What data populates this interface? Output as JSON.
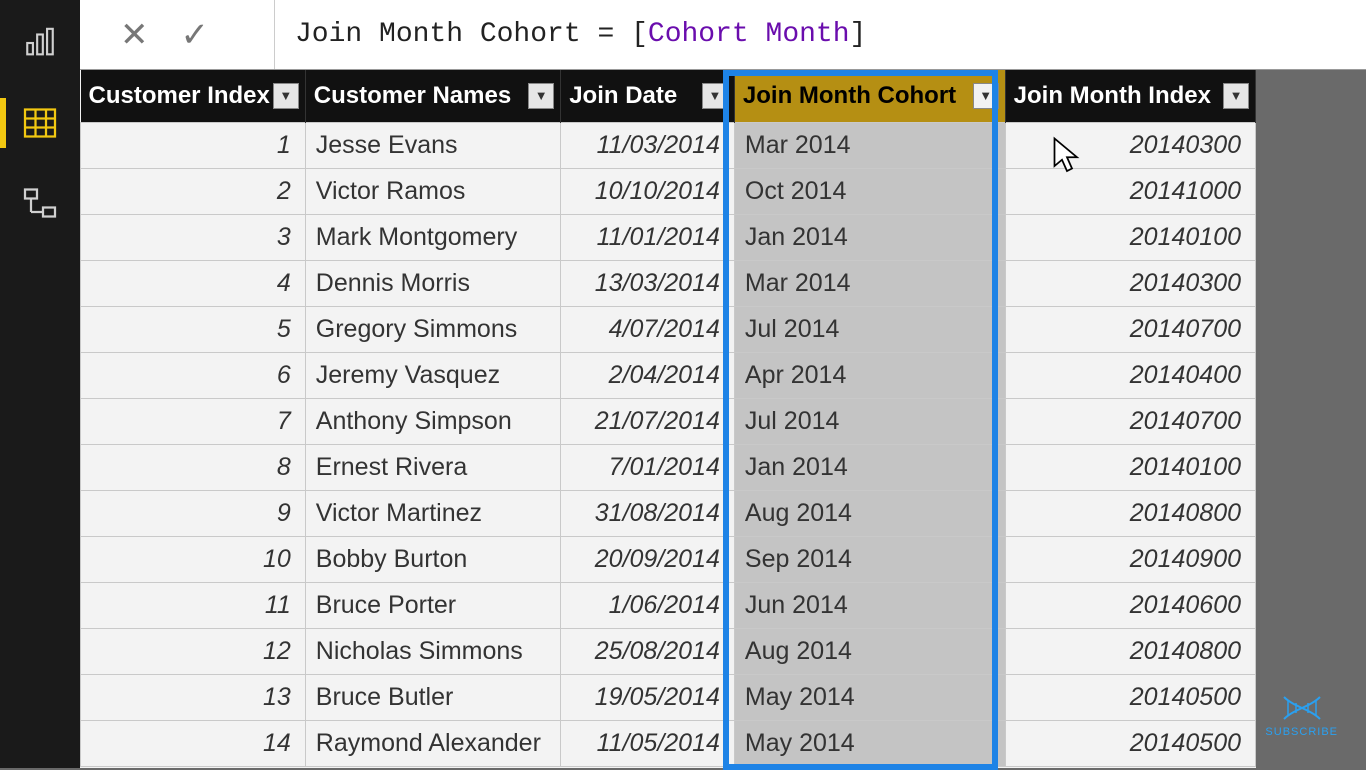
{
  "formula": {
    "lhs": "Join Month Cohort",
    "eq": " = ",
    "rhs_open": "[",
    "rhs_ref": "Cohort Month",
    "rhs_close": "]"
  },
  "columns": {
    "c1": "Customer Index",
    "c2": "Customer Names",
    "c3": "Join Date",
    "c4": "Join Month Cohort",
    "c5": "Join Month Index"
  },
  "rows": [
    {
      "idx": "1",
      "name": "Jesse Evans",
      "date": "11/03/2014",
      "cohort": "Mar 2014",
      "monthidx": "20140300"
    },
    {
      "idx": "2",
      "name": "Victor Ramos",
      "date": "10/10/2014",
      "cohort": "Oct 2014",
      "monthidx": "20141000"
    },
    {
      "idx": "3",
      "name": "Mark Montgomery",
      "date": "11/01/2014",
      "cohort": "Jan 2014",
      "monthidx": "20140100"
    },
    {
      "idx": "4",
      "name": "Dennis Morris",
      "date": "13/03/2014",
      "cohort": "Mar 2014",
      "monthidx": "20140300"
    },
    {
      "idx": "5",
      "name": "Gregory Simmons",
      "date": "4/07/2014",
      "cohort": "Jul 2014",
      "monthidx": "20140700"
    },
    {
      "idx": "6",
      "name": "Jeremy Vasquez",
      "date": "2/04/2014",
      "cohort": "Apr 2014",
      "monthidx": "20140400"
    },
    {
      "idx": "7",
      "name": "Anthony Simpson",
      "date": "21/07/2014",
      "cohort": "Jul 2014",
      "monthidx": "20140700"
    },
    {
      "idx": "8",
      "name": "Ernest Rivera",
      "date": "7/01/2014",
      "cohort": "Jan 2014",
      "monthidx": "20140100"
    },
    {
      "idx": "9",
      "name": "Victor Martinez",
      "date": "31/08/2014",
      "cohort": "Aug 2014",
      "monthidx": "20140800"
    },
    {
      "idx": "10",
      "name": "Bobby Burton",
      "date": "20/09/2014",
      "cohort": "Sep 2014",
      "monthidx": "20140900"
    },
    {
      "idx": "11",
      "name": "Bruce Porter",
      "date": "1/06/2014",
      "cohort": "Jun 2014",
      "monthidx": "20140600"
    },
    {
      "idx": "12",
      "name": "Nicholas Simmons",
      "date": "25/08/2014",
      "cohort": "Aug 2014",
      "monthidx": "20140800"
    },
    {
      "idx": "13",
      "name": "Bruce Butler",
      "date": "19/05/2014",
      "cohort": "May 2014",
      "monthidx": "20140500"
    },
    {
      "idx": "14",
      "name": "Raymond Alexander",
      "date": "11/05/2014",
      "cohort": "May 2014",
      "monthidx": "20140500"
    }
  ],
  "watermark": "SUBSCRIBE"
}
